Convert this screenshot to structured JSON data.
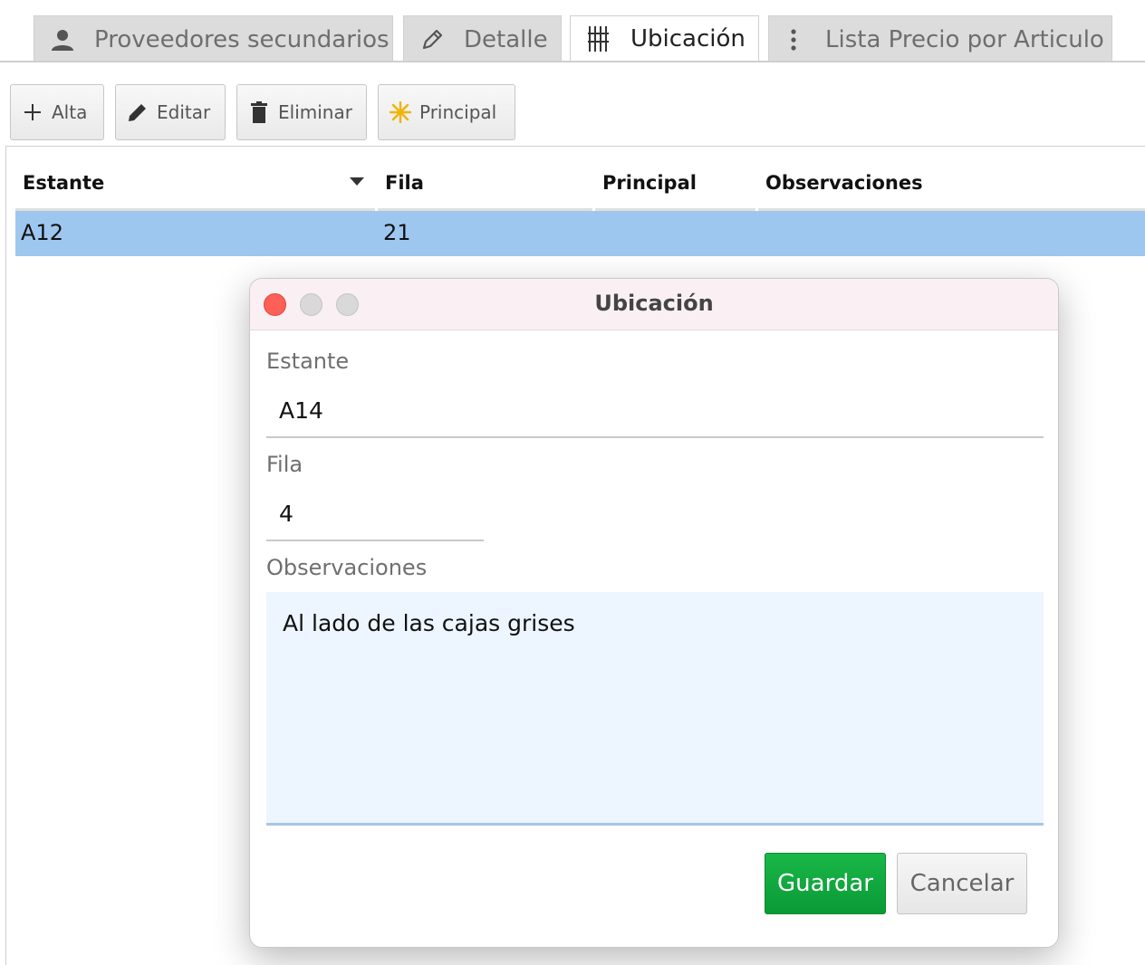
{
  "tabs": [
    {
      "label": "Proveedores secundarios",
      "icon": "person-icon",
      "active": false
    },
    {
      "label": "Detalle",
      "icon": "pencil-icon",
      "active": false
    },
    {
      "label": "Ubicación",
      "icon": "shelves-icon",
      "active": true
    },
    {
      "label": "Lista Precio por Articulo",
      "icon": "vertical-dots-icon",
      "active": false
    }
  ],
  "toolbar": {
    "alta_label": "Alta",
    "editar_label": "Editar",
    "eliminar_label": "Eliminar",
    "principal_label": "Principal"
  },
  "table": {
    "columns": [
      "Estante",
      "Fila",
      "Principal",
      "Observaciones"
    ],
    "rows": [
      {
        "estante": "A12",
        "fila": "21",
        "principal": "",
        "observaciones": ""
      }
    ],
    "sorted_column": "Estante",
    "selected_row_color": "#9ec7ef"
  },
  "dialog": {
    "title": "Ubicación",
    "fields": {
      "estante_label": "Estante",
      "estante_value": "A14",
      "fila_label": "Fila",
      "fila_value": "4",
      "observaciones_label": "Observaciones",
      "observaciones_value": "Al lado de las cajas grises"
    },
    "save_label": "Guardar",
    "cancel_label": "Cancelar",
    "save_color": "#10a93e"
  }
}
